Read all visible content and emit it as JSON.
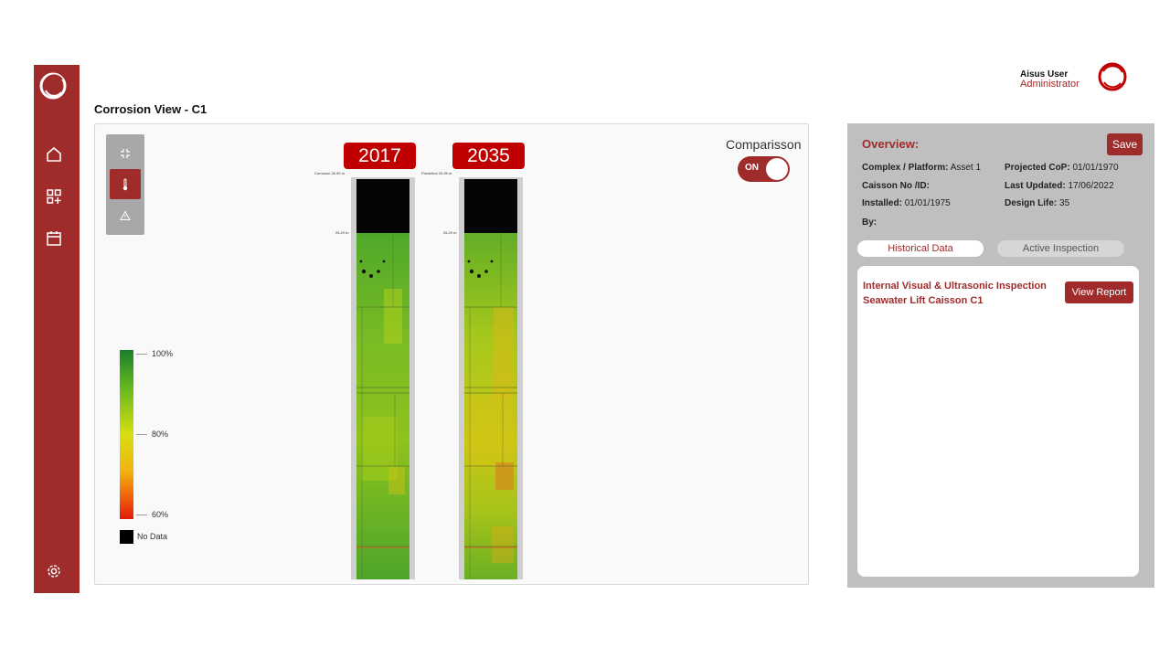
{
  "header": {
    "user_name": "Aisus User",
    "user_role": "Administrator"
  },
  "page": {
    "title": "Corrosion View - C1"
  },
  "sidebar": {
    "items": [
      "home-icon",
      "add-dashboard-icon",
      "calendar-icon",
      "gear-icon"
    ]
  },
  "viewer": {
    "tools": [
      "compress-icon",
      "thermometer-icon",
      "warning-icon"
    ],
    "comparison_label": "Comparisson",
    "toggle_state": "ON",
    "columns": [
      {
        "year": "2017",
        "top_label": "Corrosion  26.99 m",
        "depth_label": "26.29 m"
      },
      {
        "year": "2035",
        "top_label": "Prediction  26.99 m",
        "depth_label": "26.29 m"
      }
    ],
    "legend": {
      "high": "100%",
      "mid": "80%",
      "low": "60%",
      "no_data": "No Data"
    },
    "colors": {
      "high": "#1a7f2a",
      "mid": "#d6de12",
      "low": "#e01a0a",
      "no_data": "#000000"
    }
  },
  "overview": {
    "title": "Overview:",
    "save_label": "Save",
    "complex_label": "Complex / Platform:",
    "complex_value": "Asset 1",
    "projected_label": "Projected CoP:",
    "projected_value": "01/01/1970",
    "caisson_label": "Caisson No /ID:",
    "caisson_value": "",
    "updated_label": "Last Updated:",
    "updated_value": "17/06/2022",
    "installed_label": "Installed:",
    "installed_value": "01/01/1975",
    "design_label": "Design Life:",
    "design_value": "35",
    "by_label": "By:",
    "by_value": "",
    "tabs": [
      "Historical Data",
      "Active Inspection"
    ],
    "report_title": "Internal Visual & Ultrasonic Inspection Seawater Lift Caisson C1",
    "report_button": "View Report"
  },
  "accent_color": "#a02b2b"
}
